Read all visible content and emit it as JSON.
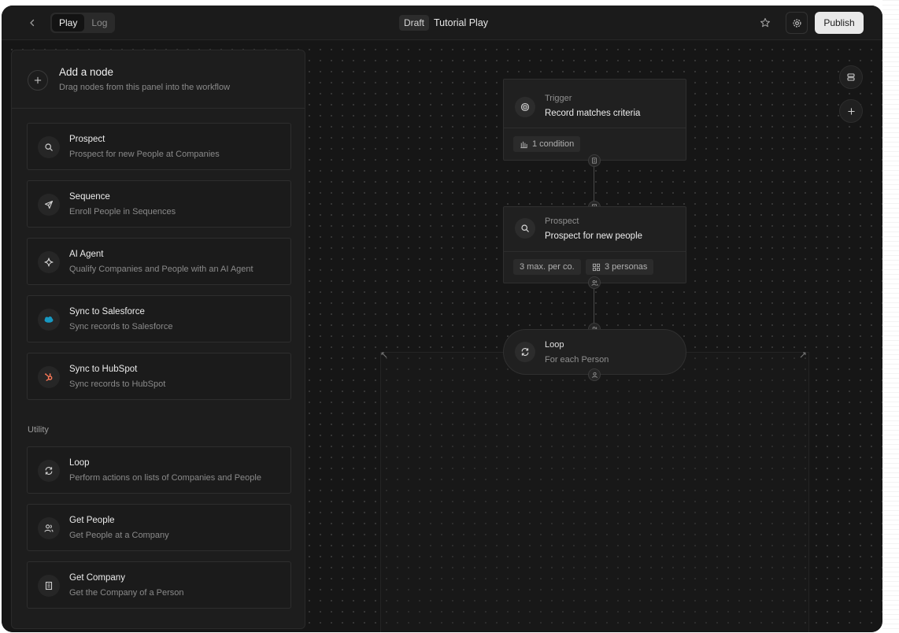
{
  "topbar": {
    "tabs": [
      {
        "label": "Play",
        "active": true
      },
      {
        "label": "Log",
        "active": false
      }
    ],
    "draft_label": "Draft",
    "play_title": "Tutorial Play",
    "publish_label": "Publish"
  },
  "panel": {
    "title": "Add a node",
    "subtitle": "Drag nodes from this panel into the workflow",
    "nodes": [
      {
        "title": "Prospect",
        "desc": "Prospect for new People at Companies",
        "icon": "search-icon"
      },
      {
        "title": "Sequence",
        "desc": "Enroll People in Sequences",
        "icon": "send-icon"
      },
      {
        "title": "AI Agent",
        "desc": "Qualify Companies and People with an AI Agent",
        "icon": "sparkle-icon"
      },
      {
        "title": "Sync to Salesforce",
        "desc": "Sync records to Salesforce",
        "icon": "salesforce-icon",
        "color": "#1798c1"
      },
      {
        "title": "Sync to HubSpot",
        "desc": "Sync records to HubSpot",
        "icon": "hubspot-icon",
        "color": "#ff7a59"
      }
    ],
    "utility_label": "Utility",
    "utility_nodes": [
      {
        "title": "Loop",
        "desc": "Perform actions on lists of Companies and People",
        "icon": "loop-icon"
      },
      {
        "title": "Get People",
        "desc": "Get People at a Company",
        "icon": "people-icon"
      },
      {
        "title": "Get Company",
        "desc": "Get the Company of a Person",
        "icon": "building-icon"
      }
    ]
  },
  "workflow": {
    "trigger": {
      "label": "Trigger",
      "title": "Record matches criteria",
      "pill": "1 condition"
    },
    "prospect": {
      "label": "Prospect",
      "title": "Prospect for new people",
      "pill_max": "3 max. per co.",
      "pill_personas": "3 personas"
    },
    "loop": {
      "label": "Loop",
      "title": "For each Person"
    }
  }
}
